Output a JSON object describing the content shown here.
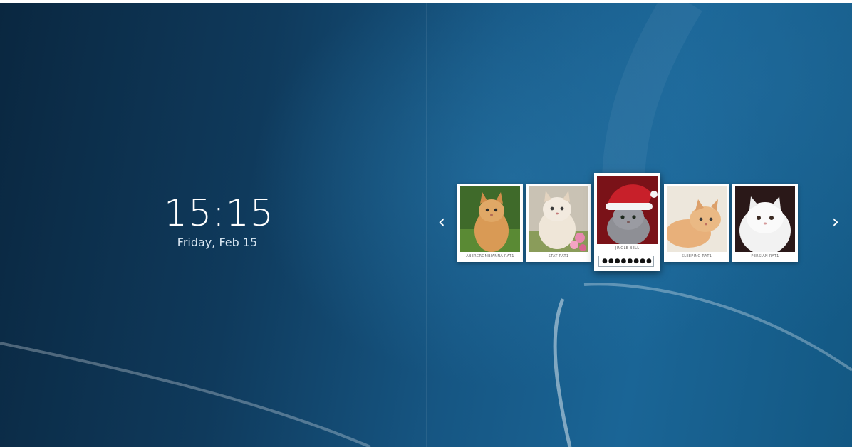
{
  "clock": {
    "time": "15:15",
    "date": "Friday, Feb 15"
  },
  "nav": {
    "prev_glyph": "‹",
    "next_glyph": "›"
  },
  "users": [
    {
      "name": "ABERCROMBIANNA RAT1",
      "photo": "cat-orange-grass",
      "active": false
    },
    {
      "name": "STAT RAT1",
      "photo": "cat-cream-flowers",
      "active": false
    },
    {
      "name": "JINGLE BELL",
      "photo": "cat-santa-hat",
      "active": true
    },
    {
      "name": "SLEEPING RAT1",
      "photo": "cat-ginger-lying",
      "active": false
    },
    {
      "name": "PERSIAN RAT1",
      "photo": "cat-white-persian",
      "active": false
    }
  ],
  "login": {
    "password_value": "●●●●●●●●"
  },
  "colors": {
    "background_dark": "#0a2740",
    "background_light": "#1a6596",
    "text": "#ffffff",
    "card": "#ffffff"
  }
}
